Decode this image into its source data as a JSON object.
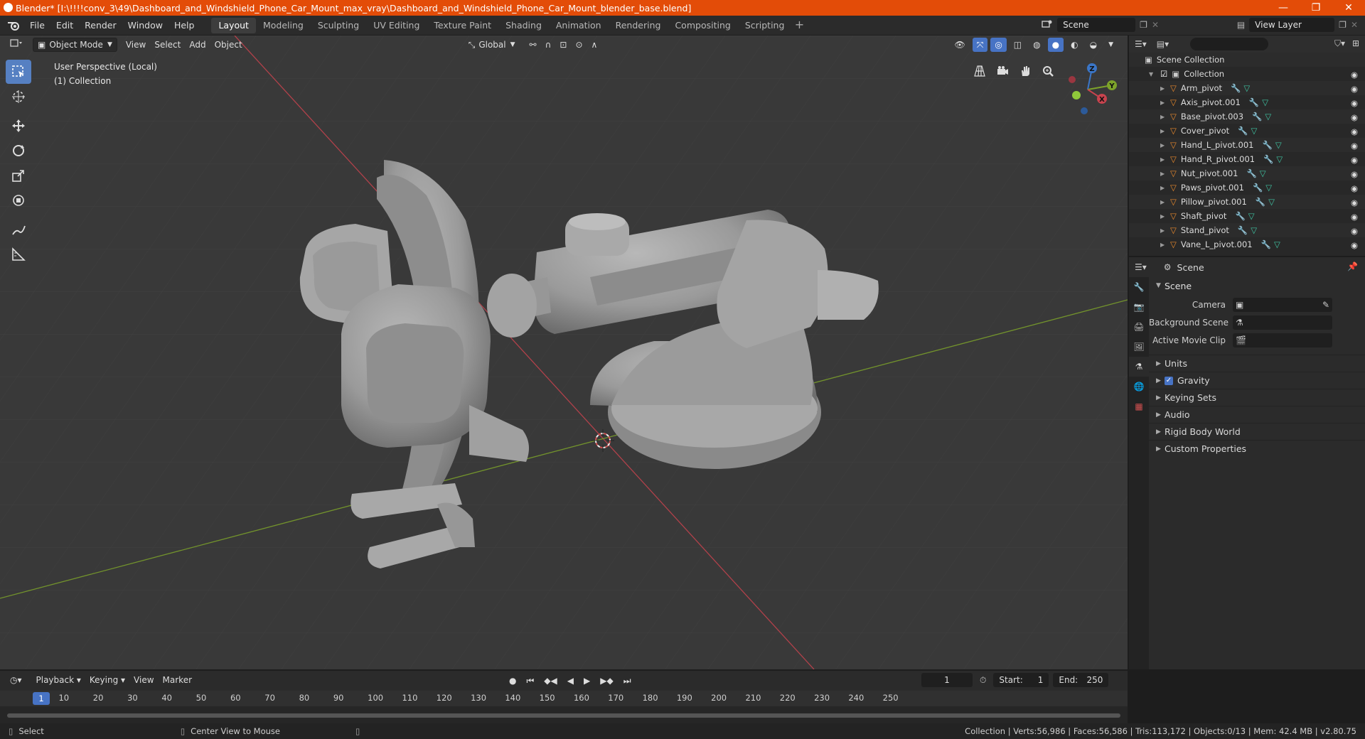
{
  "title_bar": {
    "text": "Blender* [I:\\!!!!conv_3\\49\\Dashboard_and_Windshield_Phone_Car_Mount_max_vray\\Dashboard_and_Windshield_Phone_Car_Mount_blender_base.blend]",
    "minimize": "—",
    "maximize": "❐",
    "close": "✕"
  },
  "menu": [
    "File",
    "Edit",
    "Render",
    "Window",
    "Help"
  ],
  "workspaces": [
    "Layout",
    "Modeling",
    "Sculpting",
    "UV Editing",
    "Texture Paint",
    "Shading",
    "Animation",
    "Rendering",
    "Compositing",
    "Scripting"
  ],
  "scene_name": "Scene",
  "view_layer": "View Layer",
  "viewport": {
    "mode": "Object Mode",
    "menus": [
      "View",
      "Select",
      "Add",
      "Object"
    ],
    "transform_orientation": "Global",
    "perspective_label": "User Perspective (Local)",
    "collection_label": "(1) Collection"
  },
  "gizmo_axes": {
    "x": "X",
    "y": "Y",
    "z": "Z"
  },
  "outliner": {
    "root": "Scene Collection",
    "collection": "Collection",
    "items": [
      "Arm_pivot",
      "Axis_pivot.001",
      "Base_pivot.003",
      "Cover_pivot",
      "Hand_L_pivot.001",
      "Hand_R_pivot.001",
      "Nut_pivot.001",
      "Paws_pivot.001",
      "Pillow_pivot.001",
      "Shaft_pivot",
      "Stand_pivot",
      "Vane_L_pivot.001"
    ]
  },
  "properties": {
    "header": "Scene",
    "panel": "Scene",
    "fields": [
      {
        "label": "Camera"
      },
      {
        "label": "Background Scene"
      },
      {
        "label": "Active Movie Clip"
      }
    ],
    "subpanels": [
      "Units",
      "Gravity",
      "Keying Sets",
      "Audio",
      "Rigid Body World",
      "Custom Properties"
    ]
  },
  "timeline": {
    "menus": [
      "Playback",
      "Keying",
      "View",
      "Marker"
    ],
    "current_frame": "1",
    "start_label": "Start:",
    "start": "1",
    "end_label": "End:",
    "end": "250",
    "ruler": [
      "10",
      "20",
      "30",
      "40",
      "50",
      "60",
      "70",
      "80",
      "90",
      "100",
      "110",
      "120",
      "130",
      "140",
      "150",
      "160",
      "170",
      "180",
      "190",
      "200",
      "210",
      "220",
      "230",
      "240",
      "250"
    ]
  },
  "status": {
    "left_action": "Select",
    "middle_action": "Center View to Mouse",
    "stats": "Collection | Verts:56,986 | Faces:56,586 | Tris:113,172 | Objects:0/13 | Mem: 42.4 MB | v2.80.75"
  },
  "colors": {
    "title_bar": "#e34c08",
    "accent": "#4773c4",
    "x_axis": "#c8434e",
    "y_axis": "#7da32a",
    "z_axis": "#3a76c8",
    "object_icon": "#e8892c",
    "mesh_icon": "#3fc3a2"
  }
}
